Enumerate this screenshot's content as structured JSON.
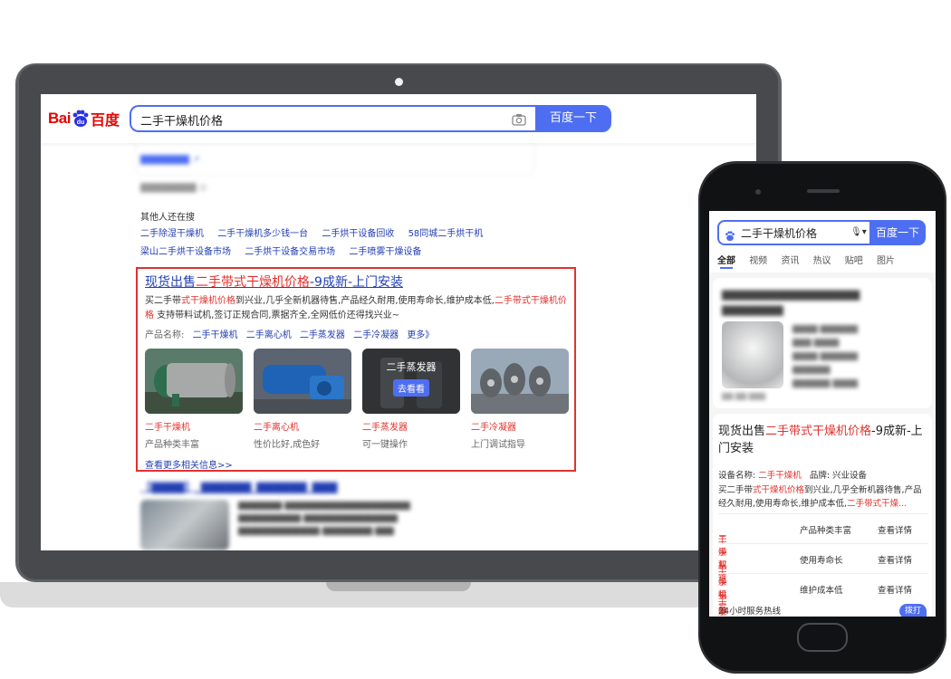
{
  "laptop": {
    "search": {
      "query": "二手干燥机价格",
      "button_label": "百度一下"
    },
    "others": {
      "title": "其他人还在搜",
      "links": [
        "二手除湿干燥机",
        "二手干燥机多少钱一台",
        "二手烘干设备回收",
        "58同城二手烘干机",
        "梁山二手烘干设备市场",
        "二手烘干设备交易市场",
        "二手喷雾干燥设备"
      ]
    },
    "ad": {
      "title_pre": "现货出售",
      "title_hl": "二手带式干燥机价格",
      "title_post": "-9成新-上门安装",
      "desc_1": "买二手带",
      "desc_2": "式干燥机价格",
      "desc_3": "到兴业,几乎全新机器待售,产品经久耐用,使用寿命长,维护成本低,",
      "desc_4": "二手带式干燥机价格",
      "desc_5": " 支持带料试机,签订正规合同,票据齐全,全网低价还得找兴业~",
      "category_label": "产品名称:",
      "category_links": [
        "二手干燥机",
        "二手离心机",
        "二手蒸发器",
        "二手冷凝器",
        "更多》"
      ],
      "tiles": [
        {
          "name": "二手干燥机",
          "sub": "产品种类丰富"
        },
        {
          "name": "二手离心机",
          "sub": "性价比好,成色好"
        },
        {
          "name": "二手蒸发器",
          "sub": "可一键操作",
          "overlay_title": "二手蒸发器",
          "overlay_btn": "去看看"
        },
        {
          "name": "二手冷凝器",
          "sub": "上门调试指导"
        }
      ],
      "more_link": "查看更多相关信息>>"
    }
  },
  "phone": {
    "search": {
      "query": "二手干燥机价格",
      "button_label": "百度一下"
    },
    "tabs": [
      "全部",
      "视频",
      "资讯",
      "热议",
      "贴吧",
      "图片"
    ],
    "ad": {
      "title_pre": "现货出售",
      "title_hl": "二手带式干燥机价格",
      "title_post": "-9成新-上门安装",
      "meta_label": "设备名称:",
      "meta_value": "二手干燥机",
      "meta_brand_label": "品牌:",
      "meta_brand_value": "兴业设备",
      "desc_1": "买二手带",
      "desc_2": "式干燥机价格",
      "desc_3": "到兴业,几乎全新机器待售,产品经久耐用,使用寿命长,维护成本低,",
      "desc_4": "二手带式干燥...",
      "rows": [
        {
          "name_pre": "二手双锥",
          "name_hl": "干燥机",
          "feature": "产品种类丰富",
          "action": "查看详情"
        },
        {
          "name_pre": "二手喷雾",
          "name_hl": "干燥机",
          "feature": "使用寿命长",
          "action": "查看详情"
        },
        {
          "name_pre": "二手耙式",
          "name_hl": "干燥机",
          "feature": "维护成本低",
          "action": "查看详情"
        }
      ],
      "footer": "24小时服务热线",
      "badge": "拨打"
    }
  },
  "colors": {
    "baidu_blue": "#4e6ef2",
    "link_blue": "#2440b3",
    "highlight_red": "#e0322d",
    "logo_red": "#e10602"
  }
}
